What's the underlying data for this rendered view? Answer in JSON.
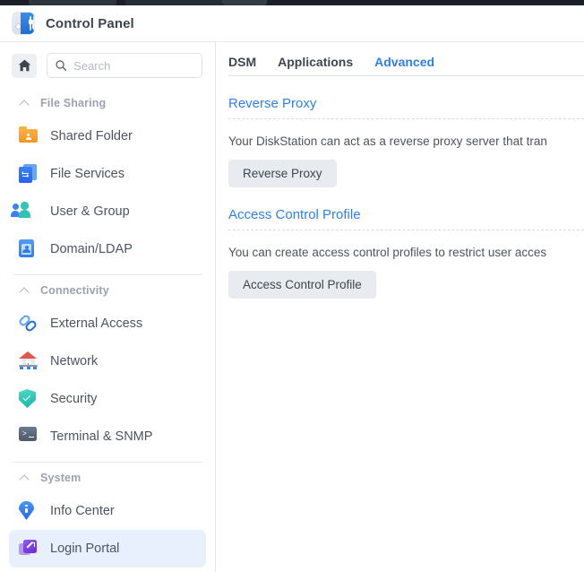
{
  "window": {
    "title": "Control Panel",
    "app_icon": "control-panel-sliders-icon"
  },
  "sidebar": {
    "home_icon": "home-icon",
    "search": {
      "icon": "search-icon",
      "placeholder": "Search",
      "value": ""
    },
    "sections": [
      {
        "label": "File Sharing",
        "collapse_icon": "chevron-up-icon",
        "items": [
          {
            "label": "Shared Folder",
            "icon": "shared-folder-icon",
            "active": false
          },
          {
            "label": "File Services",
            "icon": "file-services-icon",
            "active": false
          },
          {
            "label": "User & Group",
            "icon": "user-group-icon",
            "active": false
          },
          {
            "label": "Domain/LDAP",
            "icon": "domain-ldap-icon",
            "active": false
          }
        ]
      },
      {
        "label": "Connectivity",
        "collapse_icon": "chevron-up-icon",
        "items": [
          {
            "label": "External Access",
            "icon": "external-access-icon",
            "active": false
          },
          {
            "label": "Network",
            "icon": "network-house-icon",
            "active": false
          },
          {
            "label": "Security",
            "icon": "security-shield-icon",
            "active": false
          },
          {
            "label": "Terminal & SNMP",
            "icon": "terminal-icon",
            "active": false
          }
        ]
      },
      {
        "label": "System",
        "collapse_icon": "chevron-up-icon",
        "items": [
          {
            "label": "Info Center",
            "icon": "info-center-icon",
            "active": false
          },
          {
            "label": "Login Portal",
            "icon": "login-portal-icon",
            "active": true
          }
        ]
      }
    ]
  },
  "main": {
    "tabs": [
      {
        "label": "DSM",
        "active": false
      },
      {
        "label": "Applications",
        "active": false
      },
      {
        "label": "Advanced",
        "active": true
      }
    ],
    "sections": [
      {
        "title": "Reverse Proxy",
        "description": "Your DiskStation can act as a reverse proxy server that tran",
        "button_label": "Reverse Proxy"
      },
      {
        "title": "Access Control Profile",
        "description": "You can create access control profiles to restrict user acces",
        "button_label": "Access Control Profile"
      }
    ]
  },
  "colors": {
    "accent": "#2f7fe8",
    "active_nav_bg": "#e9f0fd",
    "text": "#4b555f",
    "muted": "#9aa3ad",
    "button_bg": "#e8ebef"
  }
}
